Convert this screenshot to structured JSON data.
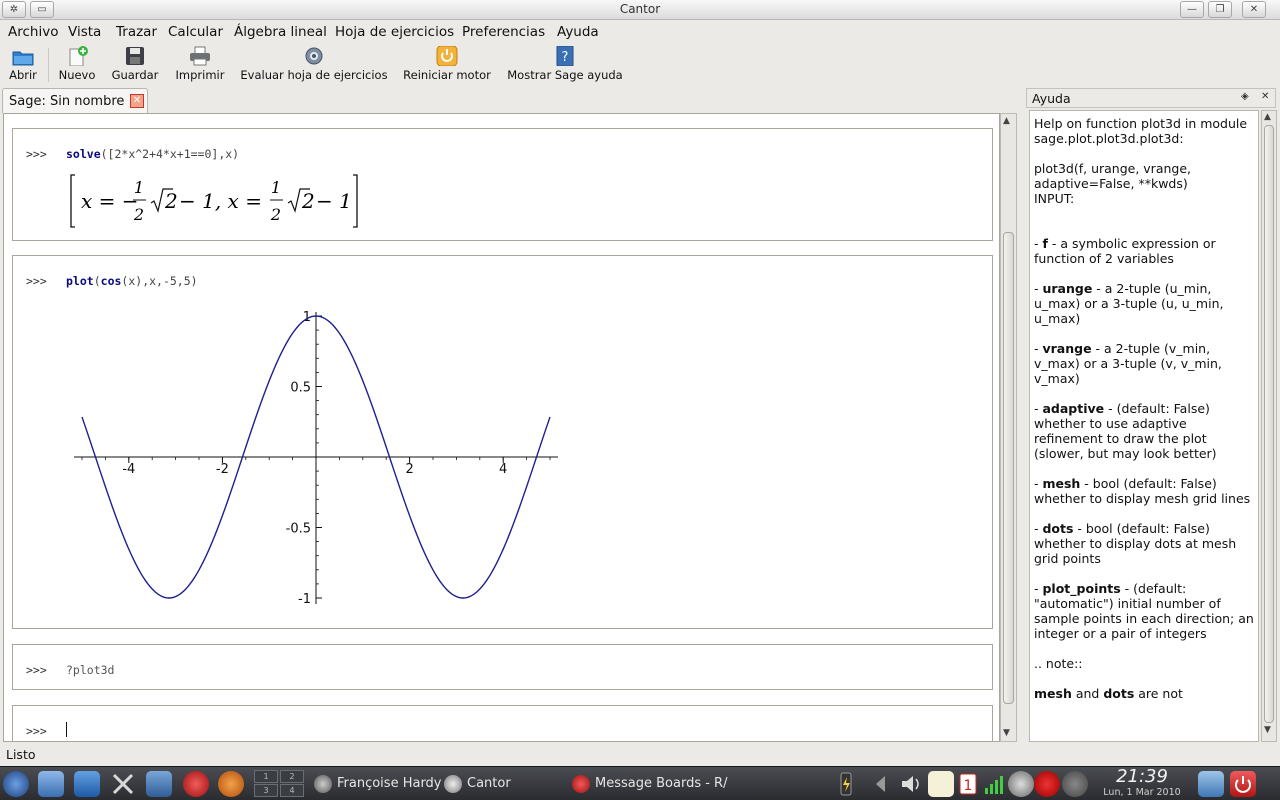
{
  "window": {
    "title": "Cantor"
  },
  "menu": [
    "Archivo",
    "Vista",
    "Trazar",
    "Calcular",
    "Álgebra lineal",
    "Hoja de ejercicios",
    "Preferencias",
    "Ayuda"
  ],
  "toolbar": {
    "abrir": "Abrir",
    "nuevo": "Nuevo",
    "guardar": "Guardar",
    "imprimir": "Imprimir",
    "evaluar": "Evaluar hoja de ejercicios",
    "reiniciar": "Reiniciar motor",
    "sage_ayuda": "Mostrar Sage ayuda"
  },
  "tab": {
    "label": "Sage: Sin nombre"
  },
  "entries": {
    "prompt": ">>>",
    "e1_fn": "solve",
    "e1_args": "([2*x^2+4*x+1==0],x)",
    "e2_fn1": "plot",
    "e2_paren1": "(",
    "e2_fn2": "cos",
    "e2_args": "(x),x,-5,5)",
    "e3_cmd": "?plot3d"
  },
  "math": {
    "lhs1": "x = −",
    "half_num": "1",
    "half_den": "2",
    "sqrt_arg": "2",
    "mid": " − 1, x = ",
    "tail": " − 1"
  },
  "chart_data": {
    "type": "line",
    "title": "",
    "xlabel": "",
    "ylabel": "",
    "function": "cos(x)",
    "xlim": [
      -5,
      5
    ],
    "ylim": [
      -1,
      1
    ],
    "x_ticks": [
      -4,
      -2,
      2,
      4
    ],
    "y_ticks": [
      -1,
      -0.5,
      0.5,
      1
    ],
    "x_tick_labels": [
      "-4",
      "-2",
      "2",
      "4"
    ],
    "y_tick_labels": [
      "-1",
      "-0.5",
      "0.5",
      "1"
    ],
    "series": [
      {
        "x": [
          -5,
          -4.5,
          -4,
          -3.5,
          -3,
          -2.5,
          -2,
          -1.5,
          -1,
          -0.5,
          0,
          0.5,
          1,
          1.5,
          2,
          2.5,
          3,
          3.5,
          4,
          4.5,
          5
        ],
        "y": [
          0.2837,
          -0.2108,
          -0.6536,
          -0.9365,
          -0.99,
          -0.8011,
          -0.4161,
          0.0707,
          0.5403,
          0.8776,
          1,
          0.8776,
          0.5403,
          0.0707,
          -0.4161,
          -0.8011,
          -0.99,
          -0.9365,
          -0.6536,
          -0.2108,
          0.2837
        ]
      }
    ],
    "line_color": "#1f1f8f",
    "grid": false
  },
  "help": {
    "title": "Ayuda",
    "intro1": "Help on function plot3d in module sage.plot.plot3d.plot3d:",
    "intro2": "plot3d(f, urange, vrange, adaptive=False, **kwds)",
    "intro3": "INPUT:",
    "f_name": "f",
    "f_text": " - a symbolic expression or function of 2 variables",
    "urange_name": "urange",
    "urange_text": " - a 2-tuple (u_min, u_max) or a 3-tuple (u, u_min, u_max)",
    "vrange_name": "vrange",
    "vrange_text": " - a 2-tuple (v_min, v_max) or a 3-tuple (v, v_min, v_max)",
    "adaptive_name": "adaptive",
    "adaptive_text": " - (default: False) whether to use adaptive refinement to draw the plot (slower, but may look better)",
    "mesh_name": "mesh",
    "mesh_text": " - bool (default: False) whether to display mesh grid lines",
    "dots_name": "dots",
    "dots_text": " - bool (default: False) whether to display dots at mesh grid points",
    "plot_points_name": "plot_points",
    "plot_points_text": " - (default: \"automatic\") initial number of sample points in each direction; an integer or a pair of integers",
    "note": ".. note::",
    "last_mesh": "mesh",
    "last_and": " and ",
    "last_dots": "dots",
    "last_rest": " are not"
  },
  "status": "Listo",
  "taskbar": {
    "task1": "Françoise Hardy",
    "task2": "Cantor",
    "task3": "Message Boards - R/",
    "time": "21:39",
    "date": "Lun, 1 Mar 2010",
    "pager": [
      "1",
      "2",
      "3",
      "4"
    ]
  }
}
